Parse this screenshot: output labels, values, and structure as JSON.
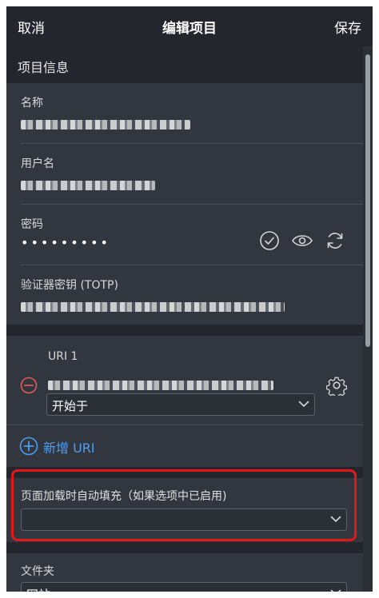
{
  "navbar": {
    "cancel_label": "取消",
    "title": "编辑项目",
    "save_label": "保存"
  },
  "item_info": {
    "section_title": "项目信息",
    "name_label": "名称",
    "username_label": "用户名",
    "password_label": "密码",
    "password_value": "•••••••••",
    "totp_label": "验证器密钥 (TOTP)"
  },
  "uris": {
    "items": [
      {
        "label": "URI 1",
        "match_option": "开始于"
      }
    ],
    "add_uri_label": "新增 URI"
  },
  "autofill": {
    "label": "页面加载时自动填充（如果选项中已启用)",
    "selected_value": ""
  },
  "folder": {
    "label": "文件夹",
    "selected_value": "网站"
  },
  "colors": {
    "accent": "#4d9ef2",
    "highlight": "#e21818",
    "danger": "#e05a5a",
    "background": "#2b2f36"
  },
  "icons": {
    "check": "check-circle-icon",
    "eye": "eye-icon",
    "refresh": "refresh-icon",
    "remove": "minus-circle-icon",
    "settings": "gear-icon",
    "add": "plus-circle-icon",
    "dropdown": "chevron-down-icon"
  }
}
